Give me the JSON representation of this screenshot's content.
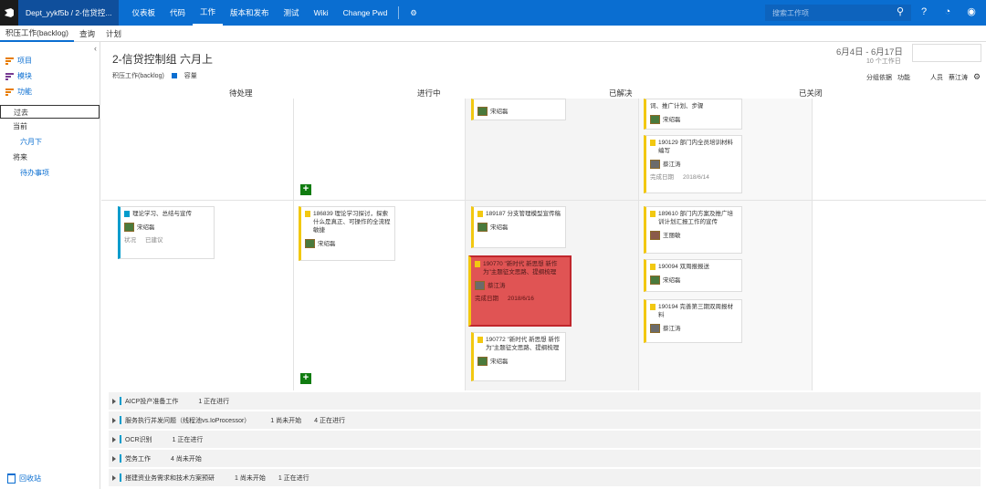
{
  "nav": {
    "project": "Dept_yykf5b / 2-信贷控...",
    "items": [
      "仪表板",
      "代码",
      "工作",
      "版本和发布",
      "测试",
      "Wiki",
      "Change Pwd"
    ],
    "active": "工作",
    "search_placeholder": "搜索工作项"
  },
  "subnav": {
    "tabs": [
      "积压工作(backlog)",
      "查询",
      "计划"
    ],
    "active": "积压工作(backlog)"
  },
  "sidebar": {
    "backlogs": [
      "项目",
      "模块",
      "功能"
    ],
    "iterations": [
      {
        "label": "过去",
        "type": "header",
        "selected": true
      },
      {
        "label": "当前",
        "type": "header"
      },
      {
        "label": "六月下",
        "type": "link"
      },
      {
        "label": "将来",
        "type": "header"
      },
      {
        "label": "待办事项",
        "type": "link"
      }
    ],
    "recycle": "回收站"
  },
  "header": {
    "title": "2-信贷控制组 六月上",
    "crumbs": [
      "积压工作(backlog)",
      "容量"
    ],
    "date_range": "6月4日 - 6月17日",
    "workdays": "10 个工作日",
    "options": [
      "分组依据",
      "功能",
      "人员",
      "蔡江涛"
    ]
  },
  "columns": [
    "待处理",
    "进行中",
    "已解决",
    "已关闭"
  ],
  "cards": {
    "c_top_resolved": {
      "person": "宋绍磊"
    },
    "c_top_closed1": {
      "title": "词、推广计划、步骤",
      "person": "宋绍磊"
    },
    "c_top_closed2": {
      "title": "190129 部门内全员培训材料编写",
      "person": "蔡江涛",
      "date_label": "完成日期",
      "date": "2018/6/14"
    },
    "c_pending": {
      "title": "理论学习、总结与宣传",
      "person": "宋绍磊",
      "state_label": "状况",
      "state": "已建议"
    },
    "c_inprog": {
      "title": "186839 理论学习探讨，探索什么是真正、可操作的全流程敏捷",
      "person": "宋绍磊"
    },
    "c_res1": {
      "title": "189187 分支管理模型宣传稿",
      "person": "宋绍磊"
    },
    "c_res2": {
      "title": "190770 \"新时代 新思想 新作为\"主题征文思路、提纲梳理",
      "person": "蔡江涛",
      "date_label": "完成日期",
      "date": "2018/6/16"
    },
    "c_res3": {
      "title": "190772 \"新时代 新思想 新作为\"主题征文思路、提纲梳理",
      "person": "宋绍磊"
    },
    "c_cl1": {
      "title": "189610 部门内方案及推广培训计划汇报工作的宣传",
      "person": "王丽敏"
    },
    "c_cl2": {
      "title": "190094 双周报报送",
      "person": "宋绍磊"
    },
    "c_cl3": {
      "title": "190194 完善第三期双周报材料",
      "person": "蔡江涛"
    }
  },
  "lanes": [
    {
      "name": "AICP投产准备工作",
      "counts": [
        "1 正在进行"
      ]
    },
    {
      "name": "服务执行并发问题（线程池vs.IoProcessor）",
      "counts": [
        "1 尚未开始",
        "4 正在进行"
      ]
    },
    {
      "name": "OCR识别",
      "counts": [
        "1 正在进行"
      ]
    },
    {
      "name": "党务工作",
      "counts": [
        "4 尚未开始"
      ]
    },
    {
      "name": "搭建资业务需求和技术方案预研",
      "counts": [
        "1 尚未开始",
        "1 正在进行"
      ]
    }
  ],
  "colors": {
    "nav": "#0a6ed1",
    "story": "#f2c811",
    "feature": "#009ccc",
    "highlight": "#e05454"
  }
}
